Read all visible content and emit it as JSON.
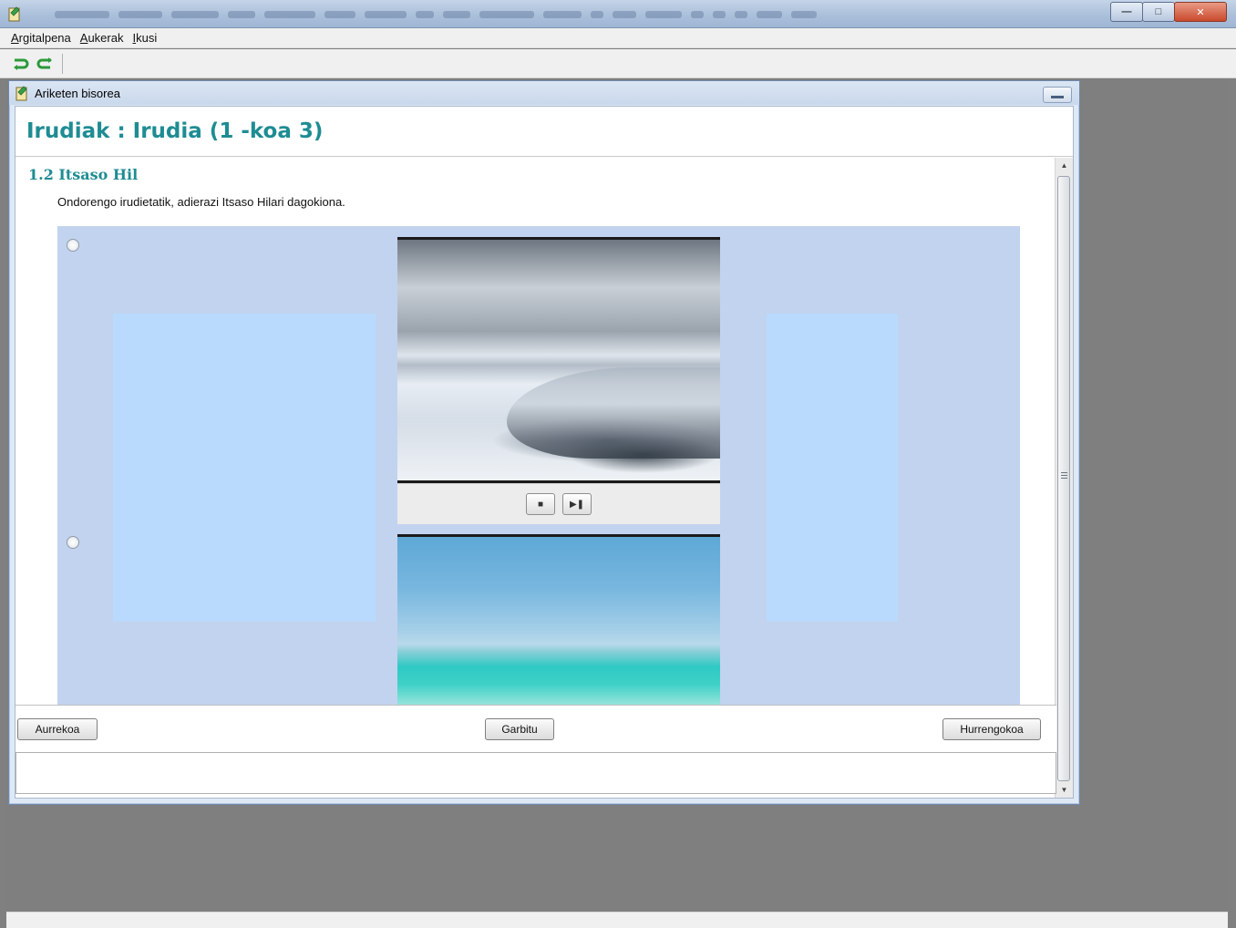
{
  "menu": {
    "items": [
      {
        "label": "Argitalpena",
        "accel": "A"
      },
      {
        "label": "Aukerak",
        "accel": "A"
      },
      {
        "label": "Ikusi",
        "accel": "I"
      }
    ]
  },
  "colors": {
    "title_teal": "#1e8c93",
    "panel_blue": "#c2d3ef",
    "side_blue": "#b9dafd"
  },
  "inner_window": {
    "title": "Ariketen bisorea"
  },
  "page": {
    "title": "Irudiak : Irudia (1 -koa 3)"
  },
  "question": {
    "section_title": "1.2 Itsaso Hil",
    "instruction": "Ondorengo irudietatik, adierazi Itsaso Hilari dagokiona."
  },
  "options": [
    {
      "image": "ice-landscape",
      "selected": false
    },
    {
      "image": "turquoise-sea",
      "selected": false
    }
  ],
  "media_controls": {
    "stop_icon": "stop-icon",
    "play_pause_icon": "play-pause-icon"
  },
  "navigation": {
    "previous": "Aurrekoa",
    "clear": "Garbitu",
    "next": "Hurrengokoa"
  }
}
